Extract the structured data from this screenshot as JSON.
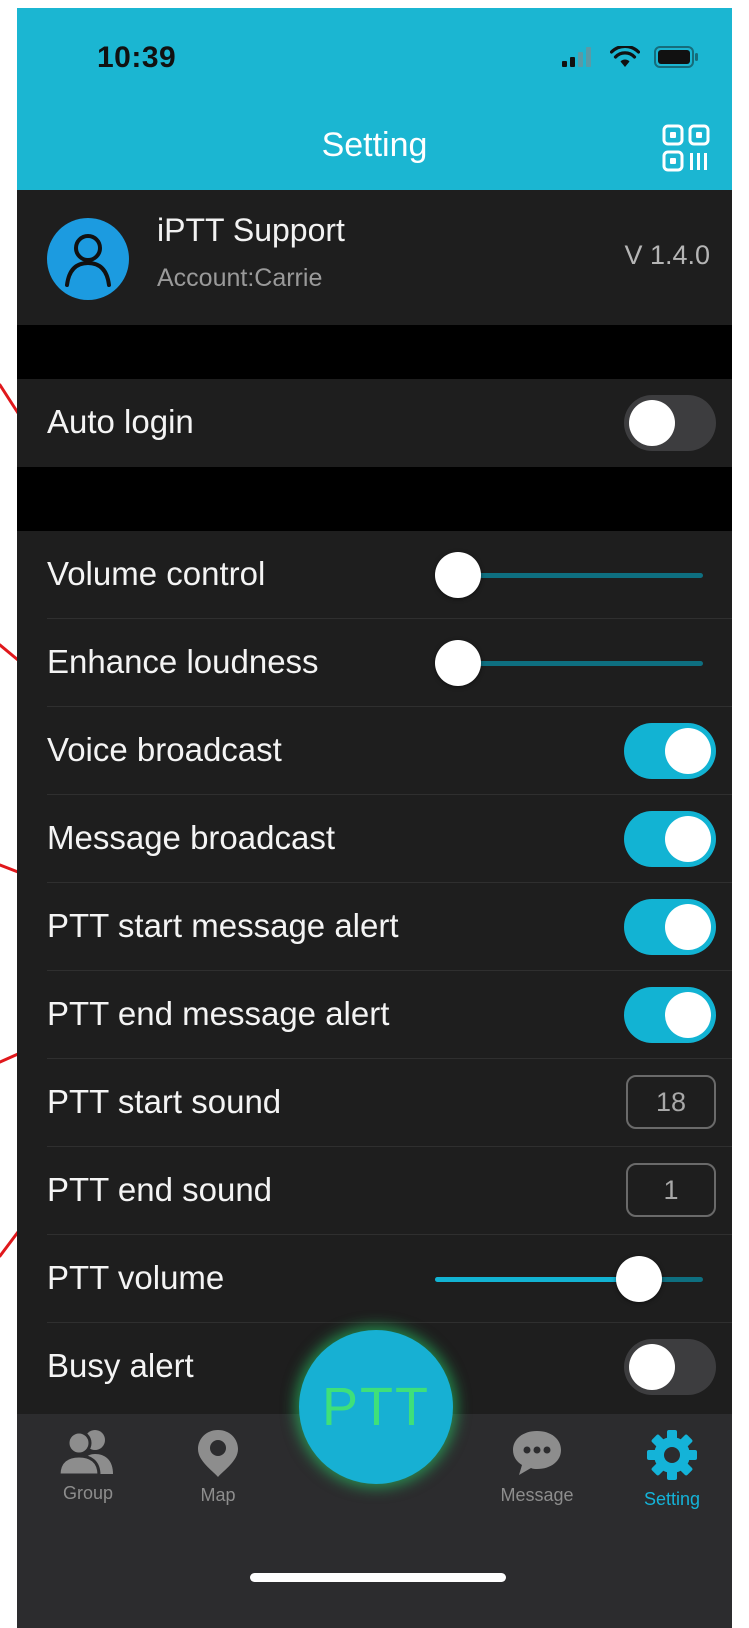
{
  "status_bar": {
    "time": "10:39"
  },
  "header": {
    "title": "Setting"
  },
  "profile": {
    "name": "iPTT Support",
    "account": "Account:Carrie",
    "version": "V 1.4.0"
  },
  "settings": {
    "auto_login": {
      "label": "Auto login",
      "enabled": false
    },
    "volume_control": {
      "label": "Volume control",
      "level": 0
    },
    "enhance_loudness": {
      "label": "Enhance loudness",
      "level": 0
    },
    "voice_broadcast": {
      "label": "Voice broadcast",
      "enabled": true
    },
    "message_broadcast": {
      "label": "Message broadcast",
      "enabled": true
    },
    "ptt_start_message_alert": {
      "label": "PTT start message alert",
      "enabled": true
    },
    "ptt_end_message_alert": {
      "label": "PTT end message alert",
      "enabled": true
    },
    "ptt_start_sound": {
      "label": "PTT start sound",
      "value": "18"
    },
    "ptt_end_sound": {
      "label": "PTT end sound",
      "value": "1"
    },
    "ptt_volume": {
      "label": "PTT volume",
      "level": 0.75
    },
    "busy_alert": {
      "label": "Busy alert",
      "enabled": false
    }
  },
  "tabbar": {
    "group": "Group",
    "map": "Map",
    "ptt": "PTT",
    "message": "Message",
    "setting": "Setting",
    "active": "setting"
  },
  "colors": {
    "accent": "#1bb6d2",
    "toggle_on": "#12b3d3",
    "avatar": "#1c9be0",
    "ptt_glow": "#3fe07a",
    "annotation": "#e0181c"
  },
  "icons": {
    "header": "qr-code-icon",
    "avatar": "person-icon",
    "tabs": [
      "group-icon",
      "map-pin-icon",
      "chat-bubble-icon",
      "gear-icon"
    ]
  }
}
